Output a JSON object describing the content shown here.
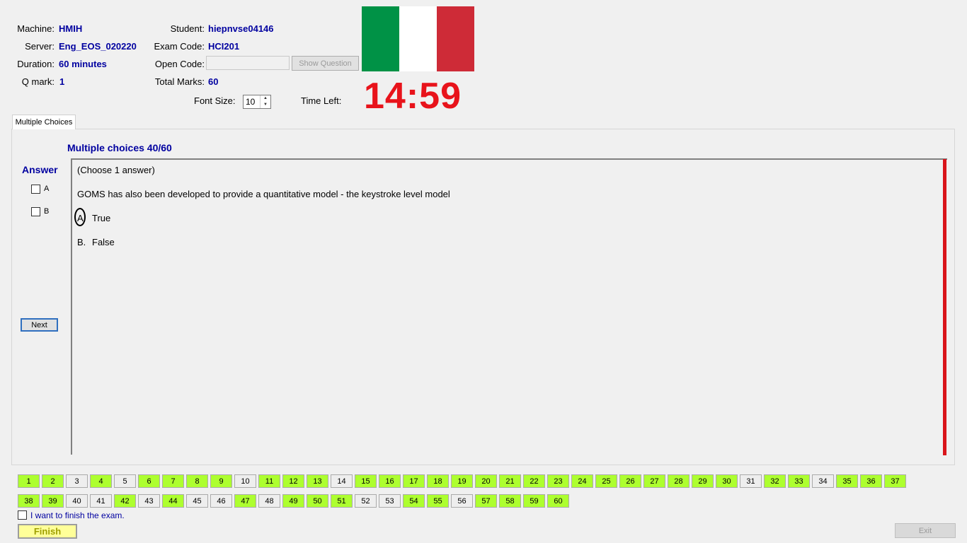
{
  "header": {
    "machine_label": "Machine:",
    "machine_value": "HMIH",
    "server_label": "Server:",
    "server_value": "Eng_EOS_020220",
    "duration_label": "Duration:",
    "duration_value": "60 minutes",
    "qmark_label": "Q mark:",
    "qmark_value": "1",
    "student_label": "Student:",
    "student_value": "hiepnvse04146",
    "exam_code_label": "Exam Code:",
    "exam_code_value": "HCI201",
    "open_code_label": "Open Code:",
    "open_code_value": "",
    "total_marks_label": "Total Marks:",
    "total_marks_value": "60",
    "show_question_label": "Show Question",
    "font_size_label": "Font Size:",
    "font_size_value": "10",
    "time_left_label": "Time Left:",
    "time_left_value": "14:59",
    "flag_colors": [
      "#009246",
      "#ffffff",
      "#ce2b37"
    ]
  },
  "tab": {
    "label": "Multiple Choices"
  },
  "question": {
    "section_title": "Multiple choices 40/60",
    "answer_title": "Answer",
    "options": [
      "A",
      "B"
    ],
    "next_label": "Next",
    "instruction": "(Choose 1 answer)",
    "text": "GOMS has also been developed to provide a quantitative model - the keystroke level model",
    "choice_a_letter": "A.",
    "choice_a_text": "True",
    "choice_b_letter": "B.",
    "choice_b_text": "False"
  },
  "navigator": {
    "answered_color": "#adff2f",
    "row1": [
      1,
      2,
      3,
      4,
      5,
      6,
      7,
      8,
      9,
      10,
      11,
      12,
      13,
      14,
      15,
      16,
      17,
      18,
      19,
      20,
      21,
      22,
      23,
      24,
      25,
      26,
      27,
      28,
      29,
      30,
      31,
      32,
      33,
      34,
      35,
      36,
      37
    ],
    "row2": [
      38,
      39,
      40,
      41,
      42,
      43,
      44,
      45,
      46,
      47,
      48,
      49,
      50,
      51,
      52,
      53,
      54,
      55,
      56,
      57,
      58,
      59,
      60
    ],
    "unanswered": [
      3,
      5,
      10,
      14,
      31,
      34,
      40,
      41,
      43,
      45,
      46,
      48,
      52,
      53,
      56
    ]
  },
  "footer": {
    "finish_checkbox_label": "I want to finish the exam.",
    "finish_label": "Finish",
    "exit_label": "Exit"
  }
}
